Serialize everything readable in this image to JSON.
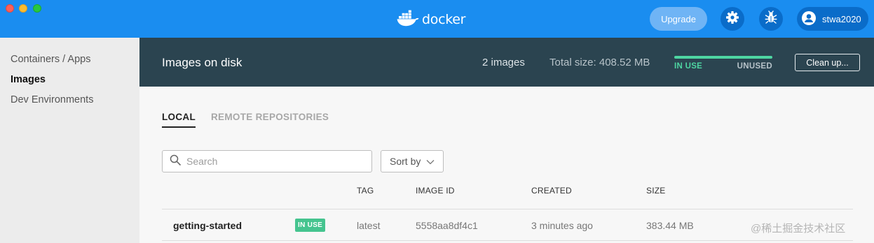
{
  "app": {
    "logo_text": "docker",
    "upgrade_label": "Upgrade",
    "username": "stwa2020",
    "accent_color": "#1a8df0"
  },
  "sidebar": {
    "items": [
      {
        "label": "Containers / Apps",
        "active": false
      },
      {
        "label": "Images",
        "active": true
      },
      {
        "label": "Dev Environments",
        "active": false
      }
    ]
  },
  "header": {
    "title": "Images on disk",
    "image_count": "2 images",
    "total_size": "Total size: 408.52 MB",
    "in_use_label": "IN USE",
    "unused_label": "UNUSED",
    "in_use_fraction": 1.0,
    "cleanup_label": "Clean up..."
  },
  "tabs": [
    {
      "label": "LOCAL",
      "active": true
    },
    {
      "label": "REMOTE REPOSITORIES",
      "active": false
    }
  ],
  "search": {
    "placeholder": "Search",
    "value": ""
  },
  "sort": {
    "label": "Sort by"
  },
  "table": {
    "columns": [
      "TAG",
      "IMAGE ID",
      "CREATED",
      "SIZE"
    ],
    "rows": [
      {
        "name": "getting-started",
        "badge": "IN USE",
        "tag": "latest",
        "image_id": "5558aa8df4c1",
        "created": "3 minutes ago",
        "size": "383.44 MB"
      }
    ]
  },
  "watermark": "@稀土掘金技术社区",
  "icons": [
    "docker-whale-icon",
    "gear-icon",
    "bug-icon",
    "user-icon",
    "search-icon",
    "chevron-down-icon"
  ]
}
